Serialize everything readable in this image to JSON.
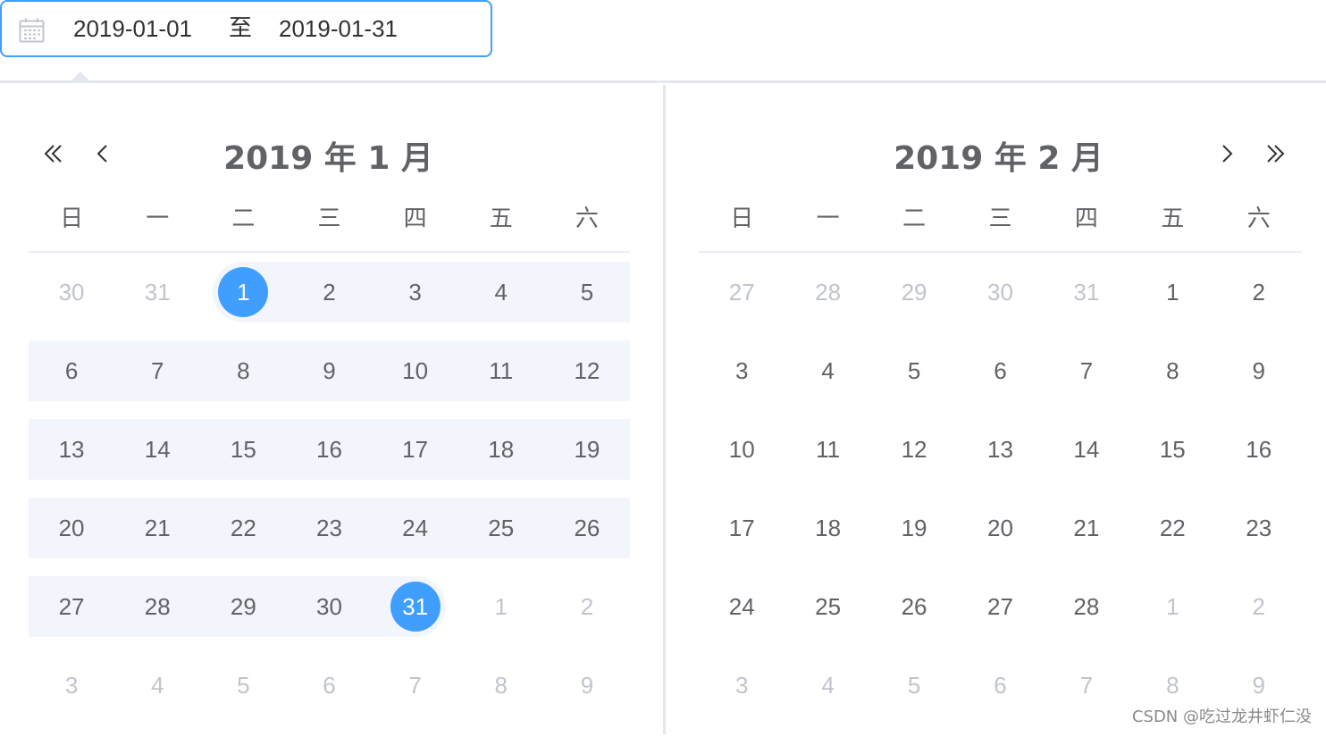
{
  "range_input": {
    "start": "2019-01-01",
    "separator": "至",
    "end": "2019-01-31",
    "icon": "calendar-icon"
  },
  "weekdays": [
    "日",
    "一",
    "二",
    "三",
    "四",
    "五",
    "六"
  ],
  "left": {
    "title": "2019 年 1 月",
    "weeks": [
      [
        {
          "d": "30",
          "t": "other"
        },
        {
          "d": "31",
          "t": "other"
        },
        {
          "d": "1",
          "t": "start"
        },
        {
          "d": "2",
          "t": "in"
        },
        {
          "d": "3",
          "t": "in"
        },
        {
          "d": "4",
          "t": "in"
        },
        {
          "d": "5",
          "t": "in"
        }
      ],
      [
        {
          "d": "6",
          "t": "in"
        },
        {
          "d": "7",
          "t": "in"
        },
        {
          "d": "8",
          "t": "in"
        },
        {
          "d": "9",
          "t": "in"
        },
        {
          "d": "10",
          "t": "in"
        },
        {
          "d": "11",
          "t": "in"
        },
        {
          "d": "12",
          "t": "in"
        }
      ],
      [
        {
          "d": "13",
          "t": "in"
        },
        {
          "d": "14",
          "t": "in"
        },
        {
          "d": "15",
          "t": "in"
        },
        {
          "d": "16",
          "t": "in"
        },
        {
          "d": "17",
          "t": "in"
        },
        {
          "d": "18",
          "t": "in"
        },
        {
          "d": "19",
          "t": "in"
        }
      ],
      [
        {
          "d": "20",
          "t": "in"
        },
        {
          "d": "21",
          "t": "in"
        },
        {
          "d": "22",
          "t": "in"
        },
        {
          "d": "23",
          "t": "in"
        },
        {
          "d": "24",
          "t": "in"
        },
        {
          "d": "25",
          "t": "in"
        },
        {
          "d": "26",
          "t": "in"
        }
      ],
      [
        {
          "d": "27",
          "t": "in"
        },
        {
          "d": "28",
          "t": "in"
        },
        {
          "d": "29",
          "t": "in"
        },
        {
          "d": "30",
          "t": "in"
        },
        {
          "d": "31",
          "t": "end"
        },
        {
          "d": "1",
          "t": "other"
        },
        {
          "d": "2",
          "t": "other"
        }
      ],
      [
        {
          "d": "3",
          "t": "other"
        },
        {
          "d": "4",
          "t": "other"
        },
        {
          "d": "5",
          "t": "other"
        },
        {
          "d": "6",
          "t": "other"
        },
        {
          "d": "7",
          "t": "other"
        },
        {
          "d": "8",
          "t": "other"
        },
        {
          "d": "9",
          "t": "other"
        }
      ]
    ]
  },
  "right": {
    "title": "2019 年 2 月",
    "weeks": [
      [
        {
          "d": "27",
          "t": "other"
        },
        {
          "d": "28",
          "t": "other"
        },
        {
          "d": "29",
          "t": "other"
        },
        {
          "d": "30",
          "t": "other"
        },
        {
          "d": "31",
          "t": "other"
        },
        {
          "d": "1",
          "t": "normal"
        },
        {
          "d": "2",
          "t": "normal"
        }
      ],
      [
        {
          "d": "3",
          "t": "normal"
        },
        {
          "d": "4",
          "t": "normal"
        },
        {
          "d": "5",
          "t": "normal"
        },
        {
          "d": "6",
          "t": "normal"
        },
        {
          "d": "7",
          "t": "normal"
        },
        {
          "d": "8",
          "t": "normal"
        },
        {
          "d": "9",
          "t": "normal"
        }
      ],
      [
        {
          "d": "10",
          "t": "normal"
        },
        {
          "d": "11",
          "t": "normal"
        },
        {
          "d": "12",
          "t": "normal"
        },
        {
          "d": "13",
          "t": "normal"
        },
        {
          "d": "14",
          "t": "normal"
        },
        {
          "d": "15",
          "t": "normal"
        },
        {
          "d": "16",
          "t": "normal"
        }
      ],
      [
        {
          "d": "17",
          "t": "normal"
        },
        {
          "d": "18",
          "t": "normal"
        },
        {
          "d": "19",
          "t": "normal"
        },
        {
          "d": "20",
          "t": "normal"
        },
        {
          "d": "21",
          "t": "normal"
        },
        {
          "d": "22",
          "t": "normal"
        },
        {
          "d": "23",
          "t": "normal"
        }
      ],
      [
        {
          "d": "24",
          "t": "normal"
        },
        {
          "d": "25",
          "t": "normal"
        },
        {
          "d": "26",
          "t": "normal"
        },
        {
          "d": "27",
          "t": "normal"
        },
        {
          "d": "28",
          "t": "normal"
        },
        {
          "d": "1",
          "t": "other"
        },
        {
          "d": "2",
          "t": "other"
        }
      ],
      [
        {
          "d": "3",
          "t": "other"
        },
        {
          "d": "4",
          "t": "other"
        },
        {
          "d": "5",
          "t": "other"
        },
        {
          "d": "6",
          "t": "other"
        },
        {
          "d": "7",
          "t": "other"
        },
        {
          "d": "8",
          "t": "other"
        },
        {
          "d": "9",
          "t": "other"
        }
      ]
    ]
  },
  "nav_icons": {
    "prev_year": "double-chevron-left-icon",
    "prev_month": "chevron-left-icon",
    "next_month": "chevron-right-icon",
    "next_year": "double-chevron-right-icon"
  },
  "colors": {
    "accent": "#409eff",
    "range_bg": "#f2f6fc",
    "text": "#606266",
    "muted": "#c0c4cc"
  },
  "watermark": "CSDN @吃过龙井虾仁没"
}
